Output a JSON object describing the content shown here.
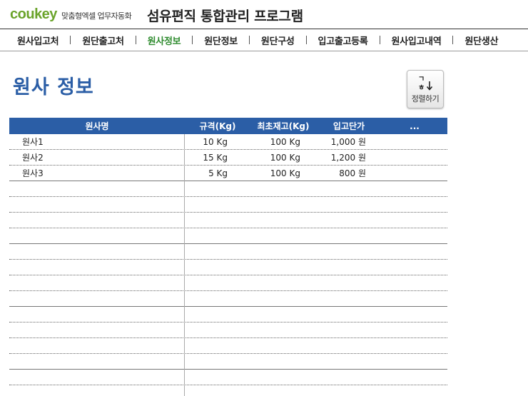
{
  "header": {
    "logo_co": "cou",
    "logo_key": "key",
    "tagline": "맞춤형엑셀 업무자동화",
    "title": "섬유편직 통합관리 프로그램"
  },
  "nav": {
    "items": [
      {
        "label": "원사입고처"
      },
      {
        "label": "원단출고처"
      },
      {
        "label": "원사정보"
      },
      {
        "label": "원단정보"
      },
      {
        "label": "원단구성"
      },
      {
        "label": "입고출고등록"
      },
      {
        "label": "원사입고내역"
      },
      {
        "label": "원단생산"
      }
    ],
    "active_index": 2
  },
  "page": {
    "title": "원사 정보"
  },
  "sort_button": {
    "label": "정렬하기",
    "icon": "sort-ga-na-down-icon",
    "icon_glyph_top": "ㄱ",
    "icon_glyph_bottom": "ㅎ"
  },
  "table": {
    "headers": [
      "원사명",
      "규격(Kg)",
      "최초재고(Kg)",
      "입고단가",
      "..."
    ],
    "rows": [
      {
        "name": "원사1",
        "spec": "10 Kg",
        "initial_stock": "100 Kg",
        "price": "1,000 원"
      },
      {
        "name": "원사2",
        "spec": "15 Kg",
        "initial_stock": "100 Kg",
        "price": "1,200 원"
      },
      {
        "name": "원사3",
        "spec": "5 Kg",
        "initial_stock": "100 Kg",
        "price": "800 원"
      }
    ],
    "empty_row_count": 13
  },
  "colors": {
    "accent_blue": "#2b5ea6",
    "active_nav_green": "#2e8b2e",
    "logo_green": "#6aa32a"
  }
}
